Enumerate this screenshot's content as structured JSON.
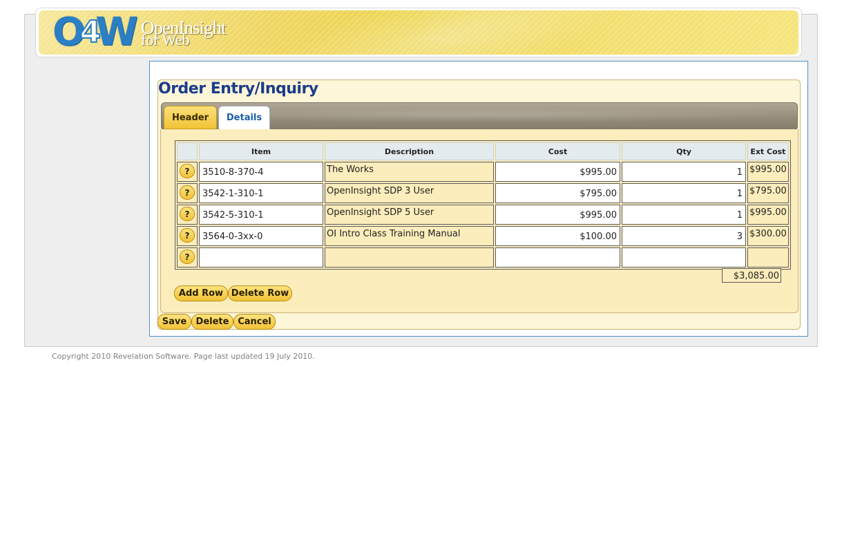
{
  "logo": {
    "mark_o": "O",
    "mark_4": "4",
    "mark_w": "W",
    "line1": "OpenInsight",
    "line2": "for Web"
  },
  "page": {
    "title": "Order Entry/Inquiry"
  },
  "tabs": {
    "header": "Header",
    "details": "Details",
    "active": "Header"
  },
  "grid": {
    "columns": [
      "",
      "Item",
      "Description",
      "Cost",
      "Qty",
      "Ext Cost"
    ],
    "lookup_label": "?",
    "rows": [
      {
        "item": "3510-8-370-4",
        "description": "The Works",
        "cost": "$995.00",
        "qty": "1",
        "ext": "$995.00"
      },
      {
        "item": "3542-1-310-1",
        "description": "OpenInsight SDP 3 User",
        "cost": "$795.00",
        "qty": "1",
        "ext": "$795.00"
      },
      {
        "item": "3542-5-310-1",
        "description": "OpenInsight SDP 5 User",
        "cost": "$995.00",
        "qty": "1",
        "ext": "$995.00"
      },
      {
        "item": "3564-0-3xx-0",
        "description": "OI Intro Class Training Manual",
        "cost": "$100.00",
        "qty": "3",
        "ext": "$300.00"
      },
      {
        "item": "",
        "description": "",
        "cost": "",
        "qty": "",
        "ext": ""
      }
    ],
    "total": "$3,085.00"
  },
  "grid_buttons": {
    "add_row": "Add Row",
    "delete_row": "Delete Row"
  },
  "form_buttons": {
    "save": "Save",
    "delete": "Delete",
    "cancel": "Cancel"
  },
  "footer": {
    "text": "Copyright 2010 Revelation Software. Page last updated 19 July 2010."
  },
  "colors": {
    "title": "#1a3c8c",
    "button": "#f2c236",
    "panel": "#fcedbc",
    "frame_border": "#4a90c8"
  }
}
